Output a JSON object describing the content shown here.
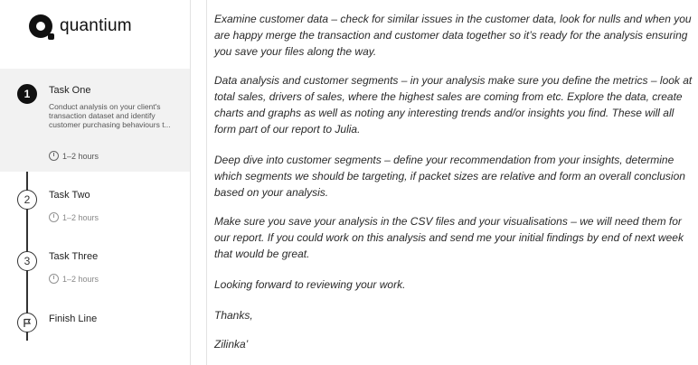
{
  "brand": {
    "name": "quantium"
  },
  "tasks": [
    {
      "number": "1",
      "title": "Task One",
      "description": "Conduct analysis on your client's transaction dataset and identify customer purchasing behaviours t...",
      "duration": "1–2 hours",
      "active": true
    },
    {
      "number": "2",
      "title": "Task Two",
      "duration": "1–2 hours",
      "active": false
    },
    {
      "number": "3",
      "title": "Task Three",
      "duration": "1–2 hours",
      "active": false
    },
    {
      "number": "",
      "title": "Finish Line",
      "icon": "flag-icon",
      "active": false
    }
  ],
  "body": {
    "paragraphs": [
      "Examine customer data – check for similar issues in the customer data, look for nulls and when you are happy merge the transaction and customer data together so it’s ready for the analysis ensuring you save your files along the way.",
      "Data analysis and customer segments – in your analysis make sure you define the metrics – look at total sales, drivers of sales, where the highest sales are coming from etc. Explore the data, create charts and graphs as well as noting any interesting trends and/or insights you find. These will all form part of our report to Julia.",
      "Deep dive into customer segments – define your recommendation from your insights, determine which segments we should be targeting, if packet sizes are relative and form an overall conclusion based on your analysis.",
      "Make sure you save your analysis in the CSV files and your visualisations – we will need them for our report. If you could work on this analysis and send me your initial findings by end of next week that would be great.",
      "Looking forward to reviewing your work.",
      "Thanks,",
      "Zilinka’"
    ]
  },
  "colors": {
    "active_bg": "#f2f2f2",
    "accent": "#111111",
    "text": "#2a2a2a"
  }
}
